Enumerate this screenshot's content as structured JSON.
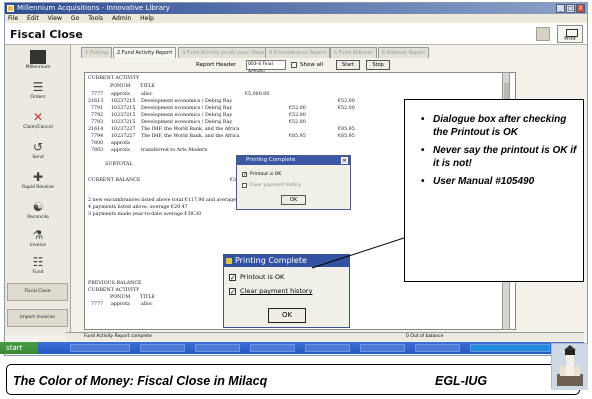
{
  "window": {
    "title": "Millennium Acquisitions - Innovative Library",
    "controls": [
      "_",
      "□",
      "X"
    ]
  },
  "menu": [
    "File",
    "Edit",
    "View",
    "Go",
    "Tools",
    "Admin",
    "Help"
  ],
  "page": {
    "title": "Fiscal Close",
    "header_button_label": "Print"
  },
  "sidebar": {
    "items": [
      "Millennium",
      "Orders",
      "Claim/Cancel",
      "Send",
      "Rapid Receive",
      "Reconcile",
      "Invoice",
      "Fund"
    ],
    "buttons": [
      "Fiscal Close",
      "Import Invoices"
    ]
  },
  "tabs": [
    {
      "label": "1.Posting"
    },
    {
      "label": "2.Fund Activity Report"
    },
    {
      "label": "3.Fund Activity (multi-year) Report"
    },
    {
      "label": "4.Encumbrance Report"
    },
    {
      "label": "5.Fund Rollover"
    },
    {
      "label": "6.Rollover Report"
    }
  ],
  "report_header": {
    "label": "Report Header",
    "selected": "003-4 Final Activity",
    "show_all_label": "Show all",
    "start_label": "Start",
    "stop_label": "Stop"
  },
  "report": {
    "section1": "CURRENT ACTIVITY",
    "col_ponum": "PONUM",
    "col_title": "TITLE",
    "rows": [
      {
        "id": "7777",
        "po": "approfa",
        "title": "alloc",
        "amt1": "€5,000.00",
        "amt2": ""
      },
      {
        "id": "21613",
        "po": "10237215",
        "title": "Development economics / Debraj Ray",
        "amt1": "",
        "amt2": "€52.00"
      },
      {
        "id": "7791",
        "po": "10237215",
        "title": "Development economics / Debraj Ray",
        "amt1": "€52.00",
        "amt2": "€52.00"
      },
      {
        "id": "7792",
        "po": "10237215",
        "title": "Development economics / Debraj Ray",
        "amt1": "€52.00",
        "amt2": ""
      },
      {
        "id": "7793",
        "po": "10237215",
        "title": "Development economics / Debraj Ray",
        "amt1": "€52.00",
        "amt2": ""
      },
      {
        "id": "21614",
        "po": "10237227",
        "title": "The IMF, the World Bank, and the Africa",
        "amt1": "",
        "amt2": "€85.95"
      },
      {
        "id": "7794",
        "po": "10237227",
        "title": "The IMF, the World Bank, and the Africa",
        "amt1": "€85.95",
        "amt2": "€85.95"
      },
      {
        "id": "7800",
        "po": "approfa",
        "title": "",
        "amt1": "",
        "amt2": ""
      },
      {
        "id": "7803",
        "po": "approfa",
        "title": "transferred to Arts Modern",
        "amt1": "",
        "amt2": ""
      }
    ],
    "subtotal_label": "SUBTOTAL",
    "current_balance_label": "CURRENT BALANCE",
    "current_balance_value": "€382.10",
    "notes": [
      "2   new encumbrances listed above total  €117.90  and average €58.95",
      "4   payments listed above, average  €29.47",
      "3   payments made year-to-date average  €39.30"
    ],
    "previous_balance_label": "PREVIOUS BALANCE",
    "previous_balance_value": "€0",
    "section2": "CURRENT ACTIVITY",
    "row_last_id": "7777",
    "row_last_po": "approfa",
    "row_last_title": "alloc"
  },
  "dialog_small": {
    "title": "Printing Complete",
    "opt1": "Printout is OK",
    "opt2": "Clear payment history",
    "ok": "OK"
  },
  "dialog_large": {
    "title": "Printing Complete",
    "opt1": "Printout is OK",
    "opt2": "Clear payment history",
    "ok": "OK"
  },
  "status": {
    "left": "Fund Activity Report complete",
    "right": "0 Out of balance"
  },
  "taskbar": {
    "start_label": "start"
  },
  "callout": {
    "bullets": [
      "Dialogue box after checking the Printout is OK",
      "Never say the printout is OK if it is not!",
      "User Manual #105490"
    ]
  },
  "footer": {
    "left": "The Color of Money: Fiscal Close in Milacq",
    "right": "EGL-IUG"
  }
}
